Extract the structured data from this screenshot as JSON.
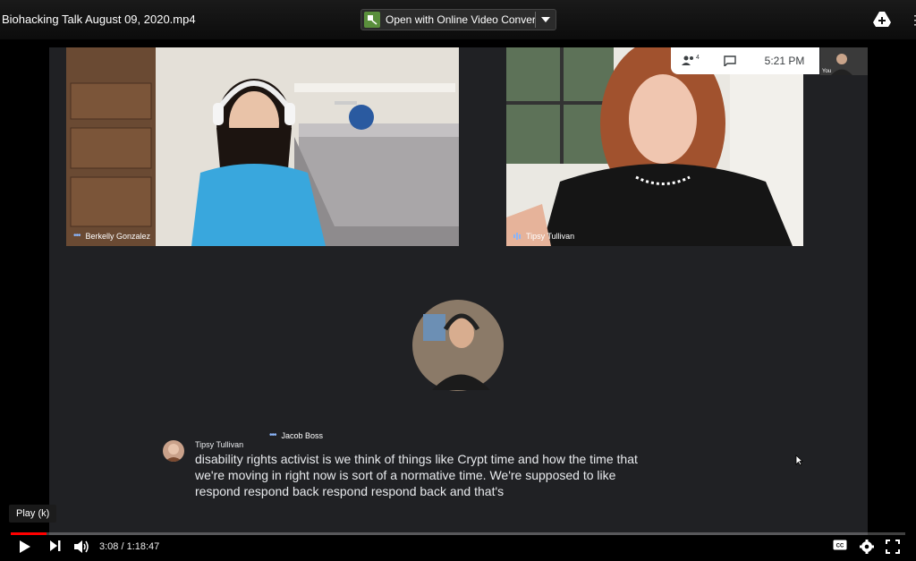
{
  "window": {
    "file_title": "Biohacking Talk August 09, 2020.mp4",
    "open_with_label": "Open with Online Video Convert…"
  },
  "meet": {
    "time": "5:21 PM",
    "participant_count": "4",
    "self_label": "You",
    "participants": [
      {
        "name": "Berkelly Gonzalez"
      },
      {
        "name": "Tipsy Tullivan"
      },
      {
        "name": "Jacob Boss"
      }
    ]
  },
  "caption": {
    "speaker": "Tipsy Tullivan",
    "text": "disability rights activist is we think of things like Crypt time and how the time that we're moving in right now is sort of a normative time. We're supposed to like respond respond back respond respond back and that's"
  },
  "player": {
    "tooltip": "Play (k)",
    "time_display": "3:08 / 1:18:47",
    "progress_fraction": 0.04
  },
  "icons": [
    "drive-add-icon",
    "people-icon",
    "chat-icon",
    "more-icon",
    "play-icon",
    "next-icon",
    "volume-icon",
    "captions-icon",
    "settings-icon",
    "fullscreen-icon",
    "dropdown-caret-icon",
    "cursor-icon"
  ]
}
